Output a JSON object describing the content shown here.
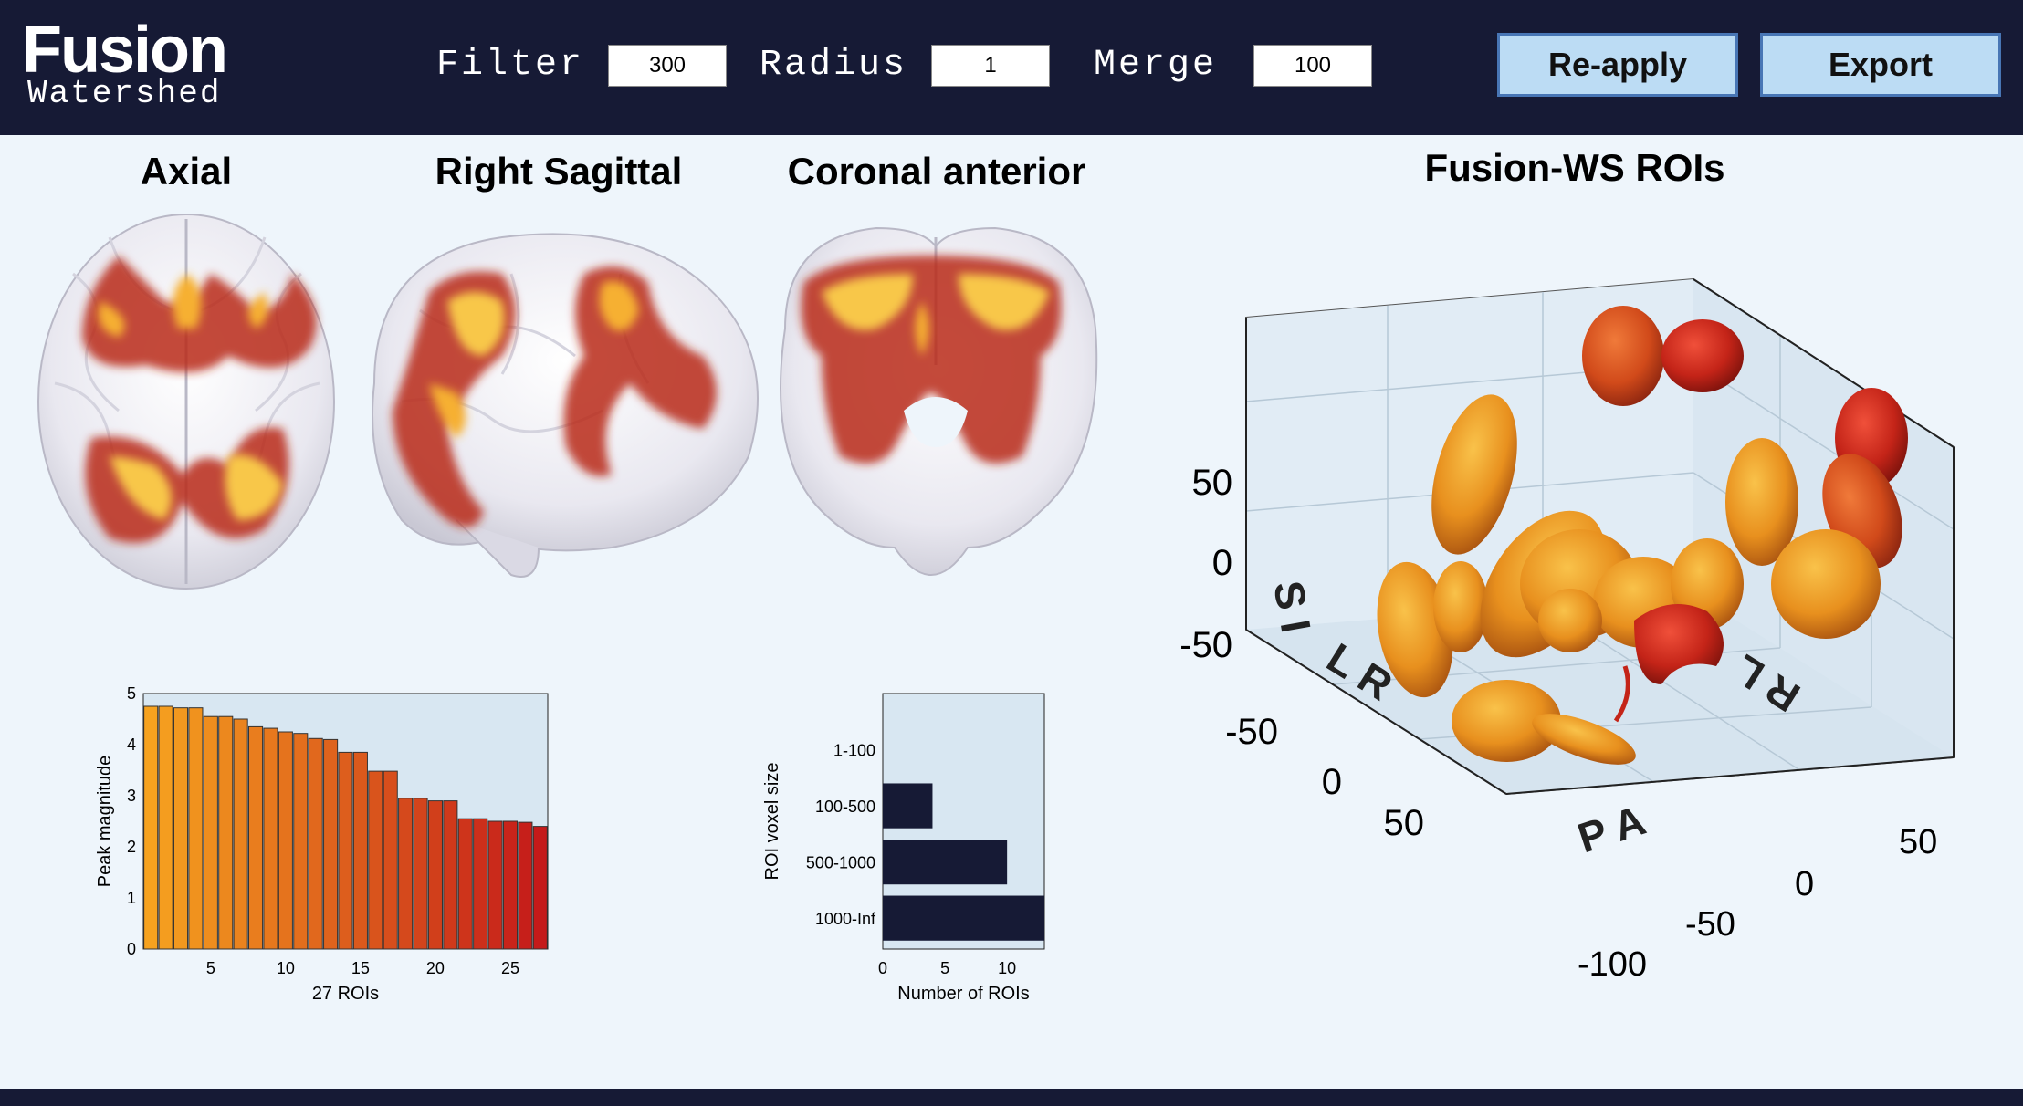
{
  "app": {
    "title": "Fusion",
    "subtitle": "Watershed"
  },
  "params": {
    "filter": {
      "label": "Filter",
      "value": "300"
    },
    "radius": {
      "label": "Radius",
      "value": "1"
    },
    "merge": {
      "label": "Merge",
      "value": "100"
    }
  },
  "buttons": {
    "reapply": "Re-apply",
    "export": "Export"
  },
  "views": {
    "axial": "Axial",
    "sagittal": "Right Sagittal",
    "coronal": "Coronal anterior",
    "rois3d": "Fusion-WS ROIs"
  },
  "colors": {
    "topbar": "#161a35",
    "panel": "#eef5fb",
    "button": "#bcdcf4",
    "hist_bar": "#161a35",
    "heat_low": "#b02010",
    "heat_high": "#fde070"
  },
  "chart_data": [
    {
      "type": "bar",
      "x": [
        1,
        2,
        3,
        4,
        5,
        6,
        7,
        8,
        9,
        10,
        11,
        12,
        13,
        14,
        15,
        16,
        17,
        18,
        19,
        20,
        21,
        22,
        23,
        24,
        25,
        26,
        27
      ],
      "values": [
        4.75,
        4.75,
        4.72,
        4.72,
        4.55,
        4.55,
        4.5,
        4.35,
        4.32,
        4.25,
        4.22,
        4.12,
        4.1,
        3.85,
        3.85,
        3.48,
        3.48,
        2.95,
        2.95,
        2.9,
        2.9,
        2.55,
        2.55,
        2.5,
        2.5,
        2.48,
        2.4
      ],
      "xlabel": "27 ROIs",
      "ylabel": "Peak magnitude",
      "xlim": [
        0.5,
        27.5
      ],
      "ylim": [
        0,
        5
      ],
      "xticks": [
        5,
        10,
        15,
        20,
        25
      ],
      "yticks": [
        0,
        1,
        2,
        3,
        4,
        5
      ],
      "colors": [
        "#f6a21f",
        "#c41a1a"
      ]
    },
    {
      "type": "bar",
      "orientation": "horizontal",
      "categories": [
        "1-100",
        "100-500",
        "500-1000",
        "1000-Inf"
      ],
      "values": [
        0,
        4,
        10,
        13
      ],
      "xlabel": "Number of ROIs",
      "ylabel": "ROI voxel size",
      "xlim": [
        0,
        13
      ],
      "xticks": [
        0,
        5,
        10
      ]
    }
  ],
  "axes3d": {
    "z_axis_label": "S I",
    "x_axis_label": "L R",
    "y_axis_label": "P A",
    "back_label": "R L",
    "z_ticks": [
      "50",
      "0",
      "-50"
    ],
    "x_ticks": [
      "-50",
      "0",
      "50"
    ],
    "y_ticks": [
      "50",
      "0",
      "-50",
      "-100"
    ]
  }
}
